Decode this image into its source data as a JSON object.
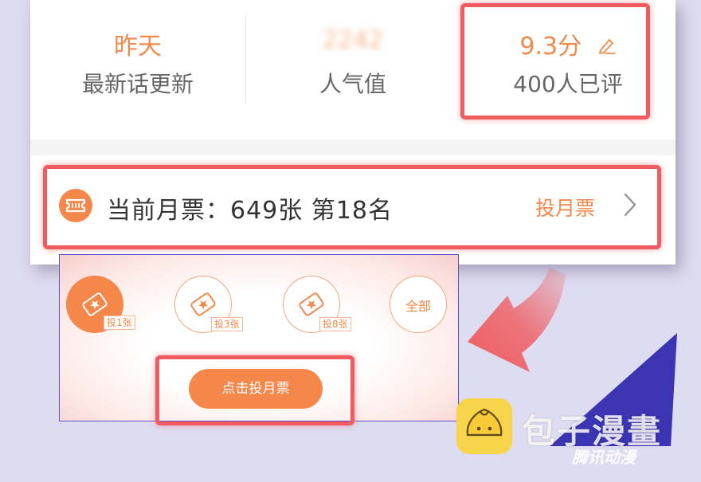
{
  "stats": [
    {
      "value": "昨天",
      "label": "最新话更新"
    },
    {
      "value": "2242",
      "label": "人气值"
    },
    {
      "value": "9.3分",
      "label": "400人已评"
    }
  ],
  "ticket": {
    "status_text": "当前月票：649张 第18名",
    "vote_link": "投月票"
  },
  "vote_panel": {
    "options": [
      {
        "badge": "投1张",
        "selected": true
      },
      {
        "badge": "投3张",
        "selected": false
      },
      {
        "badge": "投8张",
        "selected": false
      },
      {
        "label": "全部",
        "selected": false
      }
    ],
    "button": "点击投月票"
  },
  "watermark": {
    "text": "包子漫畫",
    "sub": "腾讯动漫"
  },
  "colors": {
    "accent": "#f5874a",
    "highlight": "#ef5b5f",
    "panel_border": "#5a50c8",
    "background": "#dedcf0"
  }
}
